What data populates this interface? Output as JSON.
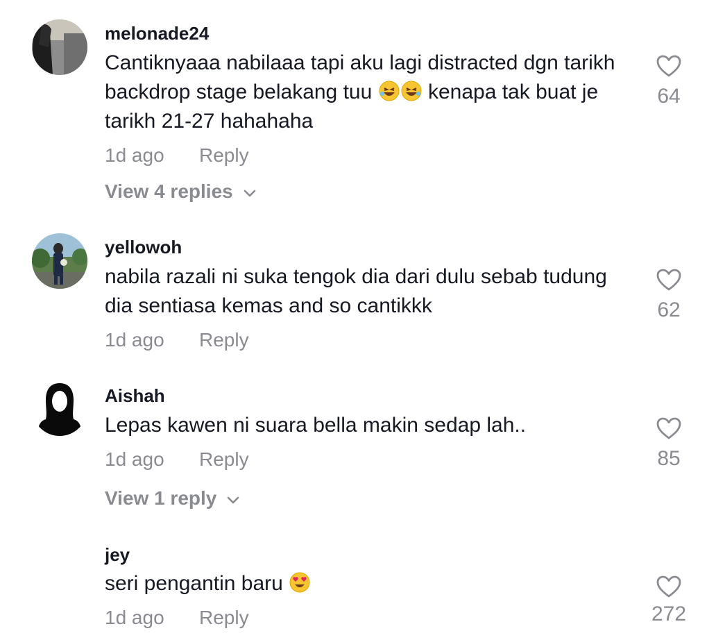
{
  "comments": [
    {
      "username": "melonade24",
      "text_before": "Cantiknyaaa nabilaaa tapi aku lagi distracted dgn tarikh backdrop stage belakang tuu ",
      "emoji1": "🤣",
      "emoji2": "🤣",
      "text_after": " kenapa tak buat je tarikh 21-27 hahahaha",
      "time": "1d ago",
      "reply_label": "Reply",
      "view_replies": "View 4 replies",
      "likes": "64"
    },
    {
      "username": "yellowoh",
      "text": "nabila razali ni suka tengok dia dari dulu sebab tudung dia sentiasa kemas and so cantikkk",
      "time": "1d ago",
      "reply_label": "Reply",
      "likes": "62"
    },
    {
      "username": "Aishah",
      "text": "Lepas kawen ni suara bella makin sedap lah..",
      "time": "1d ago",
      "reply_label": "Reply",
      "view_replies": "View 1 reply",
      "likes": "85"
    },
    {
      "username": "jey",
      "text_before": "seri pengantin baru ",
      "emoji1": "😍",
      "time": "1d ago",
      "reply_label": "Reply",
      "likes": "272"
    }
  ],
  "colors": {
    "primary_text": "#161823",
    "secondary_text": "#8a8b91",
    "icon_stroke": "#8a8b91"
  },
  "icons": {
    "like": "heart-outline-icon",
    "expand": "chevron-down-icon"
  }
}
